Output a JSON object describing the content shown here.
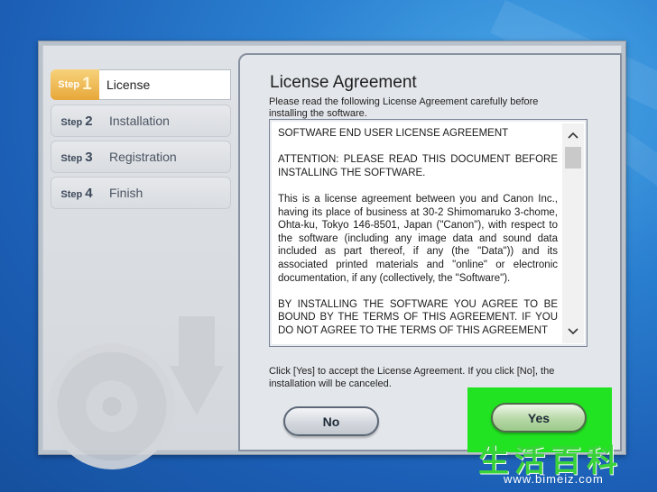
{
  "steps": [
    {
      "tag": "Step",
      "num": "1",
      "label": "License"
    },
    {
      "tag": "Step",
      "num": "2",
      "label": "Installation"
    },
    {
      "tag": "Step",
      "num": "3",
      "label": "Registration"
    },
    {
      "tag": "Step",
      "num": "4",
      "label": "Finish"
    }
  ],
  "content": {
    "title": "License Agreement",
    "intro": "Please read the following License Agreement carefully before installing the software."
  },
  "license": {
    "paragraphs": [
      "SOFTWARE END USER LICENSE AGREEMENT",
      "ATTENTION: PLEASE READ THIS DOCUMENT BEFORE INSTALLING THE SOFTWARE.",
      "This is a license agreement between you and Canon Inc., having its place of business at 30-2 Shimomaruko 3-chome, Ohta-ku, Tokyo 146-8501, Japan (\"Canon\"), with respect to the software (including any image data and sound data included as part thereof, if any (the \"Data\")) and its associated printed materials and \"online\" or electronic documentation, if any (collectively, the \"Software\").",
      "BY INSTALLING THE SOFTWARE YOU AGREE TO BE BOUND BY THE TERMS OF THIS AGREEMENT. IF YOU DO NOT AGREE TO THE TERMS OF THIS AGREEMENT"
    ]
  },
  "footer": {
    "note": "Click [Yes] to accept the License Agreement. If you click [No], the installation will be canceled."
  },
  "buttons": {
    "no": "No",
    "yes": "Yes"
  },
  "colors": {
    "highlight": "#21e321",
    "step_active": "#e7a73a"
  },
  "watermark": {
    "text": "生活百科",
    "url": "www.bimeiz.com"
  }
}
